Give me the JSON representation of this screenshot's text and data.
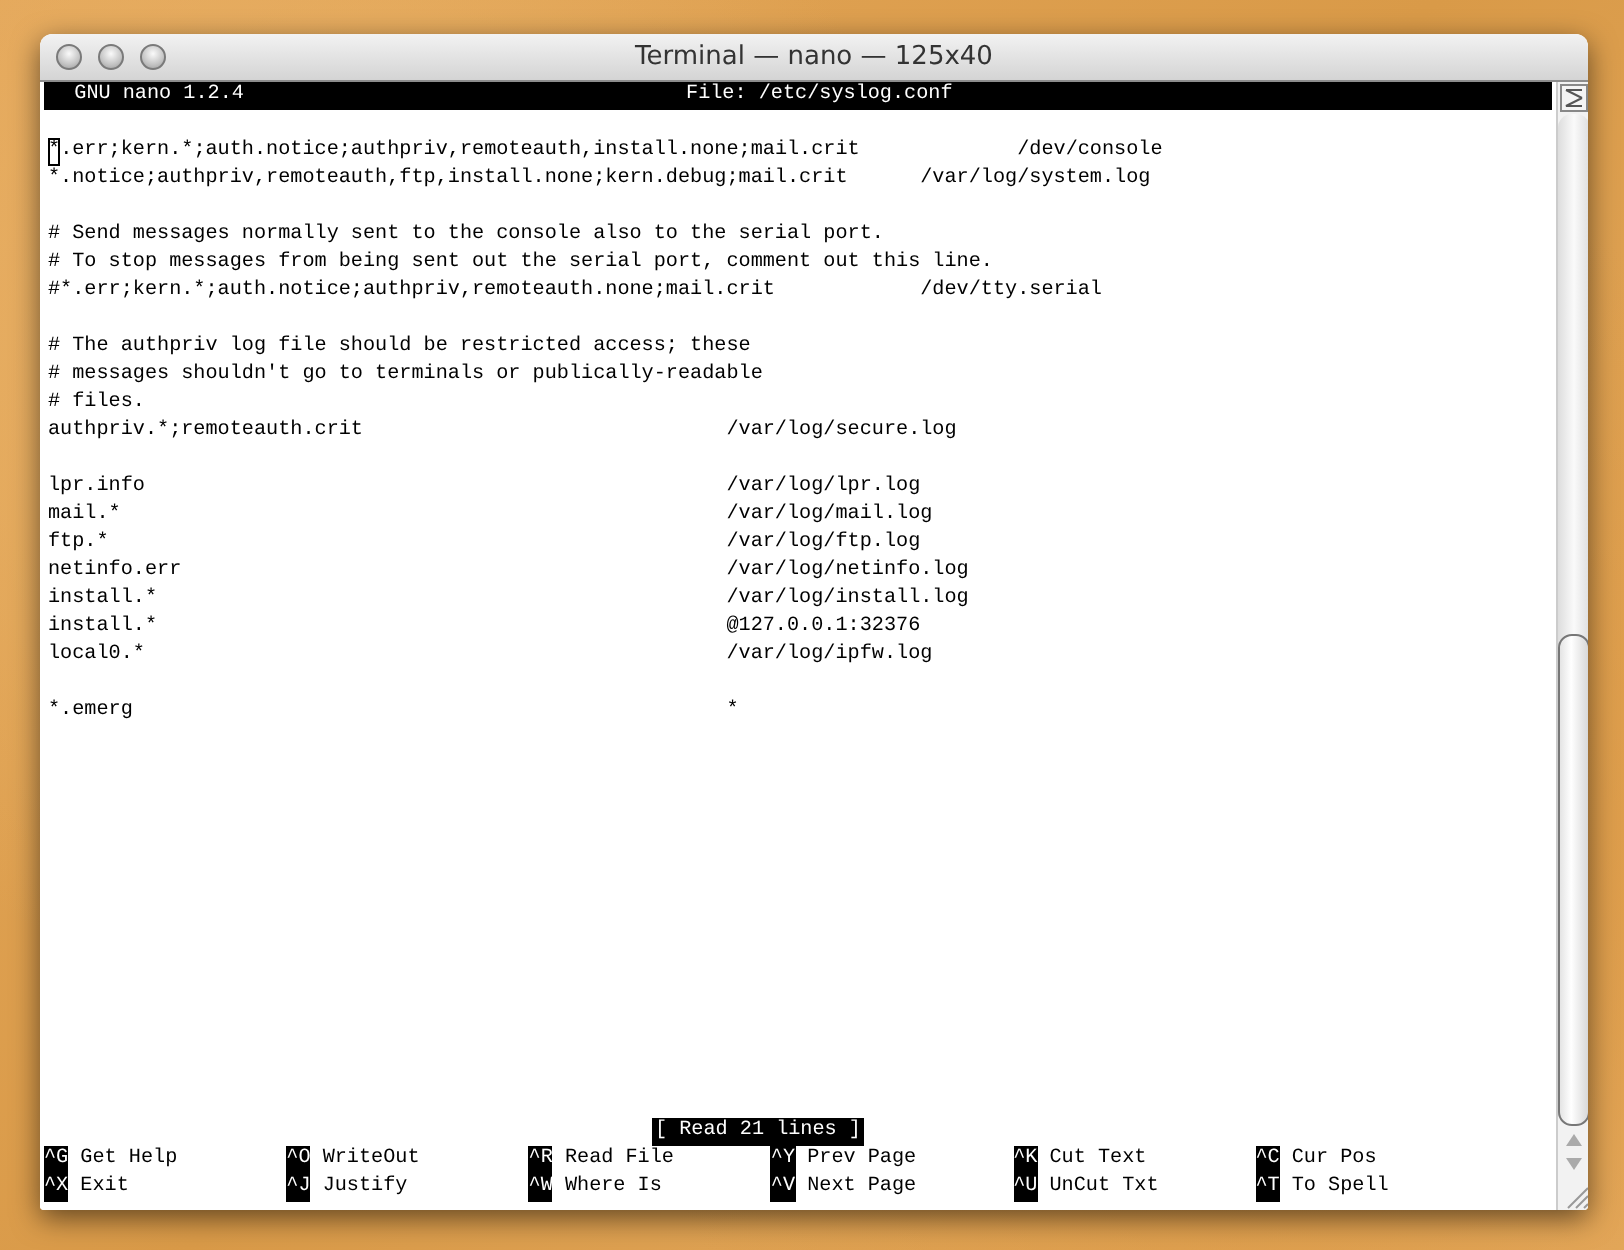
{
  "window": {
    "title": "Terminal — nano — 125x40"
  },
  "header": {
    "program": "GNU nano 1.2.4",
    "file": "File: /etc/syslog.conf"
  },
  "lines": [
    {
      "kind": "text",
      "text": "*.err;kern.*;auth.notice;authpriv,remoteauth,install.none;mail.crit             /dev/console",
      "cursor_at_start": true
    },
    {
      "kind": "text",
      "text": "*.notice;authpriv,remoteauth,ftp,install.none;kern.debug;mail.crit      /var/log/system.log"
    },
    {
      "kind": "blank"
    },
    {
      "kind": "text",
      "text": "# Send messages normally sent to the console also to the serial port."
    },
    {
      "kind": "text",
      "text": "# To stop messages from being sent out the serial port, comment out this line."
    },
    {
      "kind": "text",
      "text": "#*.err;kern.*;auth.notice;authpriv,remoteauth.none;mail.crit            /dev/tty.serial"
    },
    {
      "kind": "blank"
    },
    {
      "kind": "text",
      "text": "# The authpriv log file should be restricted access; these"
    },
    {
      "kind": "text",
      "text": "# messages shouldn't go to terminals or publically-readable"
    },
    {
      "kind": "text",
      "text": "# files."
    },
    {
      "kind": "text",
      "text": "authpriv.*;remoteauth.crit                              /var/log/secure.log"
    },
    {
      "kind": "blank"
    },
    {
      "kind": "text",
      "text": "lpr.info                                                /var/log/lpr.log"
    },
    {
      "kind": "text",
      "text": "mail.*                                                  /var/log/mail.log"
    },
    {
      "kind": "text",
      "text": "ftp.*                                                   /var/log/ftp.log"
    },
    {
      "kind": "text",
      "text": "netinfo.err                                             /var/log/netinfo.log"
    },
    {
      "kind": "text",
      "text": "install.*                                               /var/log/install.log"
    },
    {
      "kind": "text",
      "text": "install.*                                               @127.0.0.1:32376"
    },
    {
      "kind": "text",
      "text": "local0.*                                                /var/log/ipfw.log"
    },
    {
      "kind": "blank"
    },
    {
      "kind": "text",
      "text": "*.emerg                                                 *"
    }
  ],
  "status": "[ Read 21 lines ]",
  "shortcuts": [
    [
      {
        "key": "^G",
        "label": "Get Help"
      },
      {
        "key": "^O",
        "label": "WriteOut"
      },
      {
        "key": "^R",
        "label": "Read File"
      },
      {
        "key": "^Y",
        "label": "Prev Page"
      },
      {
        "key": "^K",
        "label": "Cut Text"
      },
      {
        "key": "^C",
        "label": "Cur Pos"
      }
    ],
    [
      {
        "key": "^X",
        "label": "Exit"
      },
      {
        "key": "^J",
        "label": "Justify"
      },
      {
        "key": "^W",
        "label": "Where Is"
      },
      {
        "key": "^V",
        "label": "Next Page"
      },
      {
        "key": "^U",
        "label": "UnCut Txt"
      },
      {
        "key": "^T",
        "label": "To Spell"
      }
    ]
  ]
}
